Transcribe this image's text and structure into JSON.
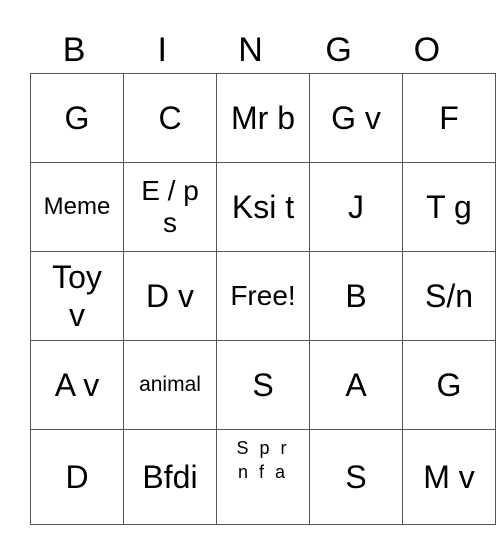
{
  "header": [
    "B",
    "I",
    "N",
    "G",
    "O"
  ],
  "rows": [
    [
      "G",
      "C",
      "Mr b",
      "G v",
      "F"
    ],
    [
      "Meme",
      "E / p s",
      "Ksi t",
      "J",
      "T g"
    ],
    [
      "Toy v",
      "D v",
      "Free!",
      "B",
      "S/n"
    ],
    [
      "A v",
      "animal",
      "S",
      "A",
      "G"
    ],
    [
      "D",
      "Bfdi",
      "S p r n f a",
      "S",
      "M v"
    ]
  ]
}
